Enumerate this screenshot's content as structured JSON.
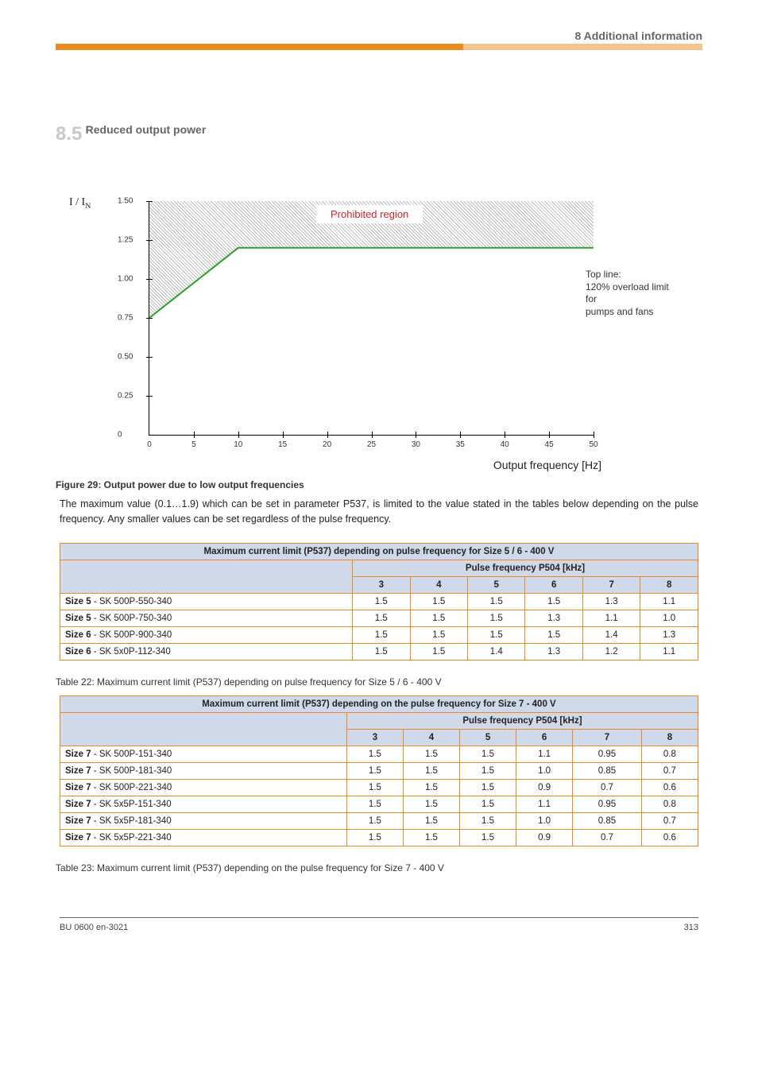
{
  "header": {
    "title": "8 Additional information"
  },
  "section": {
    "number": "8.5",
    "title": "Reduced output power"
  },
  "chart_data": {
    "type": "line",
    "title": "",
    "xlabel": "Output frequency [Hz]",
    "ylabel": "I / I_N",
    "legend": "Prohibited region",
    "side_note": "Top line:\n120% overload limit for\npumps and fans",
    "xticks": [
      0,
      5,
      10,
      15,
      20,
      25,
      30,
      35,
      40,
      45,
      50
    ],
    "yticks": [
      0,
      0.25,
      0.5,
      0.75,
      1.0,
      1.25,
      1.5
    ],
    "curve_points": [
      {
        "x": 0,
        "y": 0.75
      },
      {
        "x": 10,
        "y": 1.2
      },
      {
        "x": 50,
        "y": 1.2
      }
    ],
    "forbidden_region": "area above the green curve up to 1.5"
  },
  "figure_caption": "Figure 29: Output power due to low output frequencies",
  "paragraph": "The maximum value (0.1…1.9) which can be set in parameter P537, is limited to the value stated in the tables below depending on the pulse frequency. Any smaller values can be set regardless of the pulse frequency.",
  "table1": {
    "title": "Maximum current limit (P537) depending on pulse frequency for Size 5 / 6 - 400 V",
    "freq_header": "Pulse frequency P504 [kHz]",
    "freq_values": [
      "3",
      "4",
      "5",
      "6",
      "7",
      "8"
    ],
    "rows": [
      {
        "label": "Size 5",
        "model": "SK 500P-550-340",
        "vals": [
          "1.5",
          "1.5",
          "1.5",
          "1.5",
          "1.3",
          "1.1"
        ]
      },
      {
        "label": "Size 5",
        "model": "SK 500P-750-340",
        "vals": [
          "1.5",
          "1.5",
          "1.5",
          "1.3",
          "1.1",
          "1.0"
        ]
      },
      {
        "label": "Size 6",
        "model": "SK 500P-900-340",
        "vals": [
          "1.5",
          "1.5",
          "1.5",
          "1.5",
          "1.4",
          "1.3"
        ]
      },
      {
        "label": "Size 6",
        "model": "SK 5x0P-112-340",
        "vals": [
          "1.5",
          "1.5",
          "1.4",
          "1.3",
          "1.2",
          "1.1"
        ]
      }
    ],
    "table_caption": "Table 22: Maximum current limit (P537) depending on pulse frequency for Size 5 / 6 - 400 V"
  },
  "table2": {
    "title": "Maximum current limit (P537) depending on the pulse frequency for Size 7 - 400 V",
    "freq_header": "Pulse frequency P504 [kHz]",
    "freq_values": [
      "3",
      "4",
      "5",
      "6",
      "7",
      "8"
    ],
    "rows": [
      {
        "label": "Size 7",
        "model": "SK 500P-151-340",
        "vals": [
          "1.5",
          "1.5",
          "1.5",
          "1.1",
          "0.95",
          "0.8"
        ]
      },
      {
        "label": "Size 7",
        "model": "SK 500P-181-340",
        "vals": [
          "1.5",
          "1.5",
          "1.5",
          "1.0",
          "0.85",
          "0.7"
        ]
      },
      {
        "label": "Size 7",
        "model": "SK 500P-221-340",
        "vals": [
          "1.5",
          "1.5",
          "1.5",
          "0.9",
          "0.7",
          "0.6"
        ]
      },
      {
        "label": "Size 7",
        "model": "SK 5x5P-151-340",
        "vals": [
          "1.5",
          "1.5",
          "1.5",
          "1.1",
          "0.95",
          "0.8"
        ]
      },
      {
        "label": "Size 7",
        "model": "SK 5x5P-181-340",
        "vals": [
          "1.5",
          "1.5",
          "1.5",
          "1.0",
          "0.85",
          "0.7"
        ]
      },
      {
        "label": "Size 7",
        "model": "SK 5x5P-221-340",
        "vals": [
          "1.5",
          "1.5",
          "1.5",
          "0.9",
          "0.7",
          "0.6"
        ]
      }
    ],
    "table_caption": "Table 23: Maximum current limit (P537) depending on the pulse frequency for Size 7 - 400 V"
  },
  "footer": {
    "left": "BU 0600 en-3021",
    "right": "313"
  }
}
